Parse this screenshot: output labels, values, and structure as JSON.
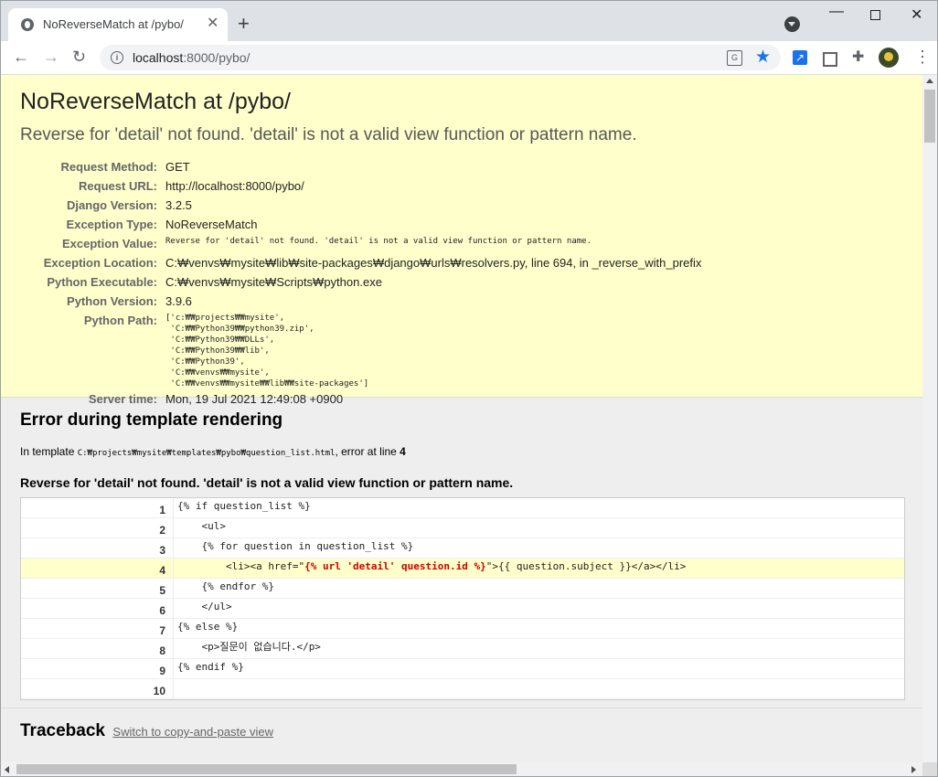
{
  "browser": {
    "tab_title": "NoReverseMatch at /pybo/",
    "tab_close": "✕",
    "new_tab": "+",
    "url_host": "localhost",
    "url_rest": ":8000/pybo/",
    "window_min": "—",
    "window_close": "✕",
    "icons": {
      "favicon": "globe-icon",
      "back": "←",
      "forward": "→",
      "reload": "↻",
      "star": "★",
      "menu": "⋮",
      "puzzle": "✚",
      "ext_arrow": "↗",
      "translate": "G",
      "info": "i"
    },
    "accent_color": "#1a73e8"
  },
  "error": {
    "title": "NoReverseMatch at /pybo/",
    "message": "Reverse for 'detail' not found. 'detail' is not a valid view function or pattern name.",
    "meta": [
      {
        "label": "Request Method:",
        "value": "GET",
        "mono": false
      },
      {
        "label": "Request URL:",
        "value": "http://localhost:8000/pybo/",
        "mono": false
      },
      {
        "label": "Django Version:",
        "value": "3.2.5",
        "mono": false
      },
      {
        "label": "Exception Type:",
        "value": "NoReverseMatch",
        "mono": false
      },
      {
        "label": "Exception Value:",
        "value": "Reverse for 'detail' not found. 'detail' is not a valid view function or pattern name.",
        "mono": true
      },
      {
        "label": "Exception Location:",
        "value": "C:₩venvs₩mysite₩lib₩site-packages₩django₩urls₩resolvers.py, line 694, in _reverse_with_prefix",
        "mono": false
      },
      {
        "label": "Python Executable:",
        "value": "C:₩venvs₩mysite₩Scripts₩python.exe",
        "mono": false
      },
      {
        "label": "Python Version:",
        "value": "3.9.6",
        "mono": false
      },
      {
        "label": "Python Path:",
        "value": "['c:₩₩projects₩₩mysite',\n 'C:₩₩Python39₩₩python39.zip',\n 'C:₩₩Python39₩₩DLLs',\n 'C:₩₩Python39₩₩lib',\n 'C:₩₩Python39',\n 'C:₩₩venvs₩₩mysite',\n 'C:₩₩venvs₩₩mysite₩₩lib₩₩site-packages']",
        "mono": true
      },
      {
        "label": "Server time:",
        "value": "Mon, 19 Jul 2021 12:49:08 +0900",
        "mono": false
      }
    ]
  },
  "template": {
    "heading": "Error during template rendering",
    "in_template_prefix": "In template ",
    "path": "C:₩projects₩mysite₩templates₩pybo₩question_list.html",
    "error_at_prefix": ", error at line ",
    "error_line": "4",
    "message": "Reverse for 'detail' not found. 'detail' is not a valid view function or pattern name.",
    "lines": [
      {
        "num": "1",
        "code": "{% if question_list %}",
        "highlight": false
      },
      {
        "num": "2",
        "code": "    <ul>",
        "highlight": false
      },
      {
        "num": "3",
        "code": "    {% for question in question_list %}",
        "highlight": false
      },
      {
        "num": "4",
        "code_before": "        <li><a href=\"",
        "code_error": "{% url 'detail' question.id %}",
        "code_after": "\">{{ question.subject }}</a></li>",
        "highlight": true
      },
      {
        "num": "5",
        "code": "    {% endfor %}",
        "highlight": false
      },
      {
        "num": "6",
        "code": "    </ul>",
        "highlight": false
      },
      {
        "num": "7",
        "code": "{% else %}",
        "highlight": false
      },
      {
        "num": "8",
        "code": "    <p>질문이 없습니다.</p>",
        "highlight": false
      },
      {
        "num": "9",
        "code": "{% endif %}",
        "highlight": false
      },
      {
        "num": "10",
        "code": "",
        "highlight": false
      }
    ]
  },
  "traceback": {
    "heading": "Traceback",
    "switch_link": "Switch to copy-and-paste view"
  }
}
